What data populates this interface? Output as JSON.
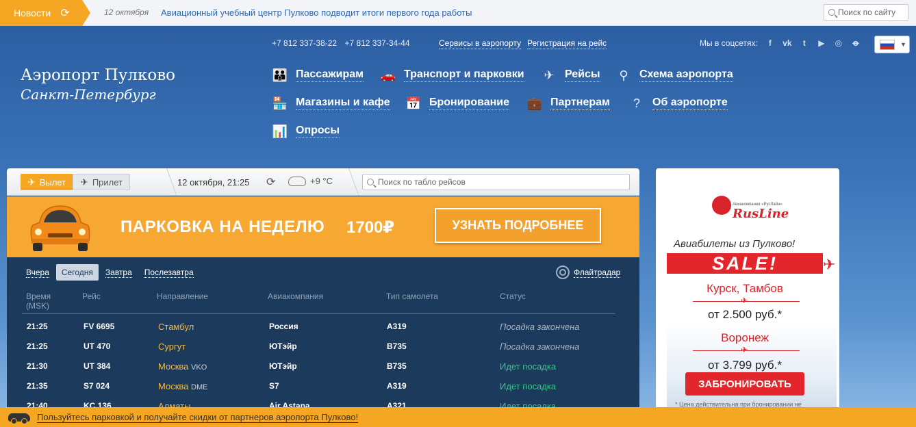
{
  "news": {
    "tab_label": "Новости",
    "date": "12 октября",
    "headline": "Авиационный учебный центр Пулково подводит итоги первого года работы"
  },
  "search": {
    "placeholder": "Поиск по сайту"
  },
  "header": {
    "phones": [
      "+7 812 337-38-22",
      "+7 812 337-34-44"
    ],
    "links": {
      "services": "Сервисы в аэропорту",
      "checkin": "Регистрация на рейс"
    },
    "social_label": "Мы в соцсетях:",
    "social_icons": [
      "facebook-icon",
      "vk-icon",
      "twitter-icon",
      "youtube-icon",
      "instagram-icon",
      "odnoklassniki-icon"
    ],
    "language": "ru"
  },
  "logo": {
    "line1": "Аэропорт Пулково",
    "line2": "Санкт-Петербург"
  },
  "menu": [
    {
      "label": "Пассажирам",
      "icon": "passengers-icon"
    },
    {
      "label": "Транспорт и парковки",
      "icon": "car-icon"
    },
    {
      "label": "Рейсы",
      "icon": "plane-icon"
    },
    {
      "label": "Схема аэропорта",
      "icon": "map-pin-icon"
    },
    {
      "label": "Магазины и кафе",
      "icon": "shop-icon"
    },
    {
      "label": "Бронирование",
      "icon": "calendar-icon"
    },
    {
      "label": "Партнерам",
      "icon": "briefcase-icon"
    },
    {
      "label": "Об аэропорте",
      "icon": "question-icon"
    },
    {
      "label": "Опросы",
      "icon": "poll-icon"
    }
  ],
  "board": {
    "tabs": {
      "departure": "Вылет",
      "arrival": "Прилет"
    },
    "datetime": "12 октября, 21:25",
    "weather": "+9 °C",
    "search_placeholder": "Поиск по табло рейсов",
    "promo": {
      "title": "ПАРКОВКА НА НЕДЕЛЮ",
      "price": "1700₽",
      "button": "УЗНАТЬ ПОДРОБНЕЕ"
    },
    "days": [
      "Вчера",
      "Сегодня",
      "Завтра",
      "Послезавтра"
    ],
    "active_day": 1,
    "flightradar": "Флайтрадар",
    "columns": {
      "time": "Время",
      "time_sub": "(MSK)",
      "flight": "Рейс",
      "direction": "Направление",
      "airline": "Авиакомпания",
      "aircraft": "Тип самолета",
      "status": "Статус"
    },
    "rows": [
      {
        "time": "21:25",
        "flight": "FV 6695",
        "dest": "Стамбул",
        "dest_code": "",
        "airline": "Россия",
        "aircraft": "A319",
        "status": "Посадка закончена",
        "status_type": "done"
      },
      {
        "time": "21:25",
        "flight": "UT 470",
        "dest": "Сургут",
        "dest_code": "",
        "airline": "ЮТэйр",
        "aircraft": "B735",
        "status": "Посадка закончена",
        "status_type": "done"
      },
      {
        "time": "21:30",
        "flight": "UT 384",
        "dest": "Москва",
        "dest_code": "VKO",
        "airline": "ЮТэйр",
        "aircraft": "B735",
        "status": "Идет посадка",
        "status_type": "boarding"
      },
      {
        "time": "21:35",
        "flight": "S7 024",
        "dest": "Москва",
        "dest_code": "DME",
        "airline": "S7",
        "aircraft": "A319",
        "status": "Идет посадка",
        "status_type": "boarding"
      },
      {
        "time": "21:40",
        "flight": "KC 136",
        "dest": "Алматы",
        "dest_code": "",
        "airline": "Air Astana",
        "aircraft": "A321",
        "status": "Идет посадка",
        "status_type": "boarding"
      }
    ]
  },
  "ad": {
    "airline_small": "Авиакомпания «РусЛайн»",
    "airline_name": "RusLine",
    "subtitle": "Авиабилеты из Пулково!",
    "sale": "SALE!",
    "route1": "Курск, Тамбов",
    "price1": "от 2.500 руб.*",
    "route2": "Воронеж",
    "price2": "от 3.799 руб.*",
    "button": "ЗАБРОНИРОВАТЬ",
    "note": "* Цена действительна при бронировании не"
  },
  "bottom": {
    "text": "Пользуйтесь парковкой и получайте скидки от партнеров аэропорта Пулково!"
  },
  "colors": {
    "accent": "#f5a623",
    "board_bg": "#1b3a5c",
    "boarding": "#3fc48a",
    "ad_red": "#e3262c"
  }
}
